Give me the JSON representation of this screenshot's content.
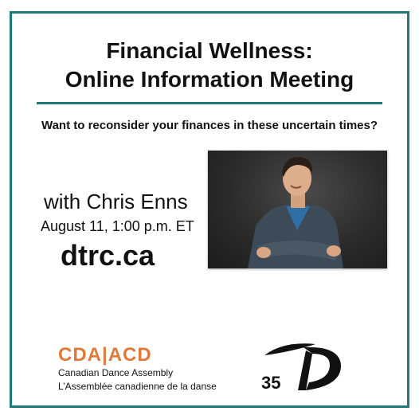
{
  "header": {
    "title_line1": "Financial Wellness:",
    "title_line2": "Online Information Meeting"
  },
  "subtitle": "Want to reconsider your finances in these uncertain times?",
  "speaker": {
    "with_text": "with Chris Enns",
    "date_text": "August 11, 1:00 p.m. ET",
    "website": "dtrc.ca"
  },
  "logos": {
    "cda_logo": "CDA|ACD",
    "cda_name_en": "Canadian Dance Assembly",
    "cda_name_fr": "L’Assemblée canadienne de la danse",
    "anniversary_number": "35"
  },
  "colors": {
    "accent": "#1f7a79",
    "cda_orange": "#e07a3a"
  }
}
